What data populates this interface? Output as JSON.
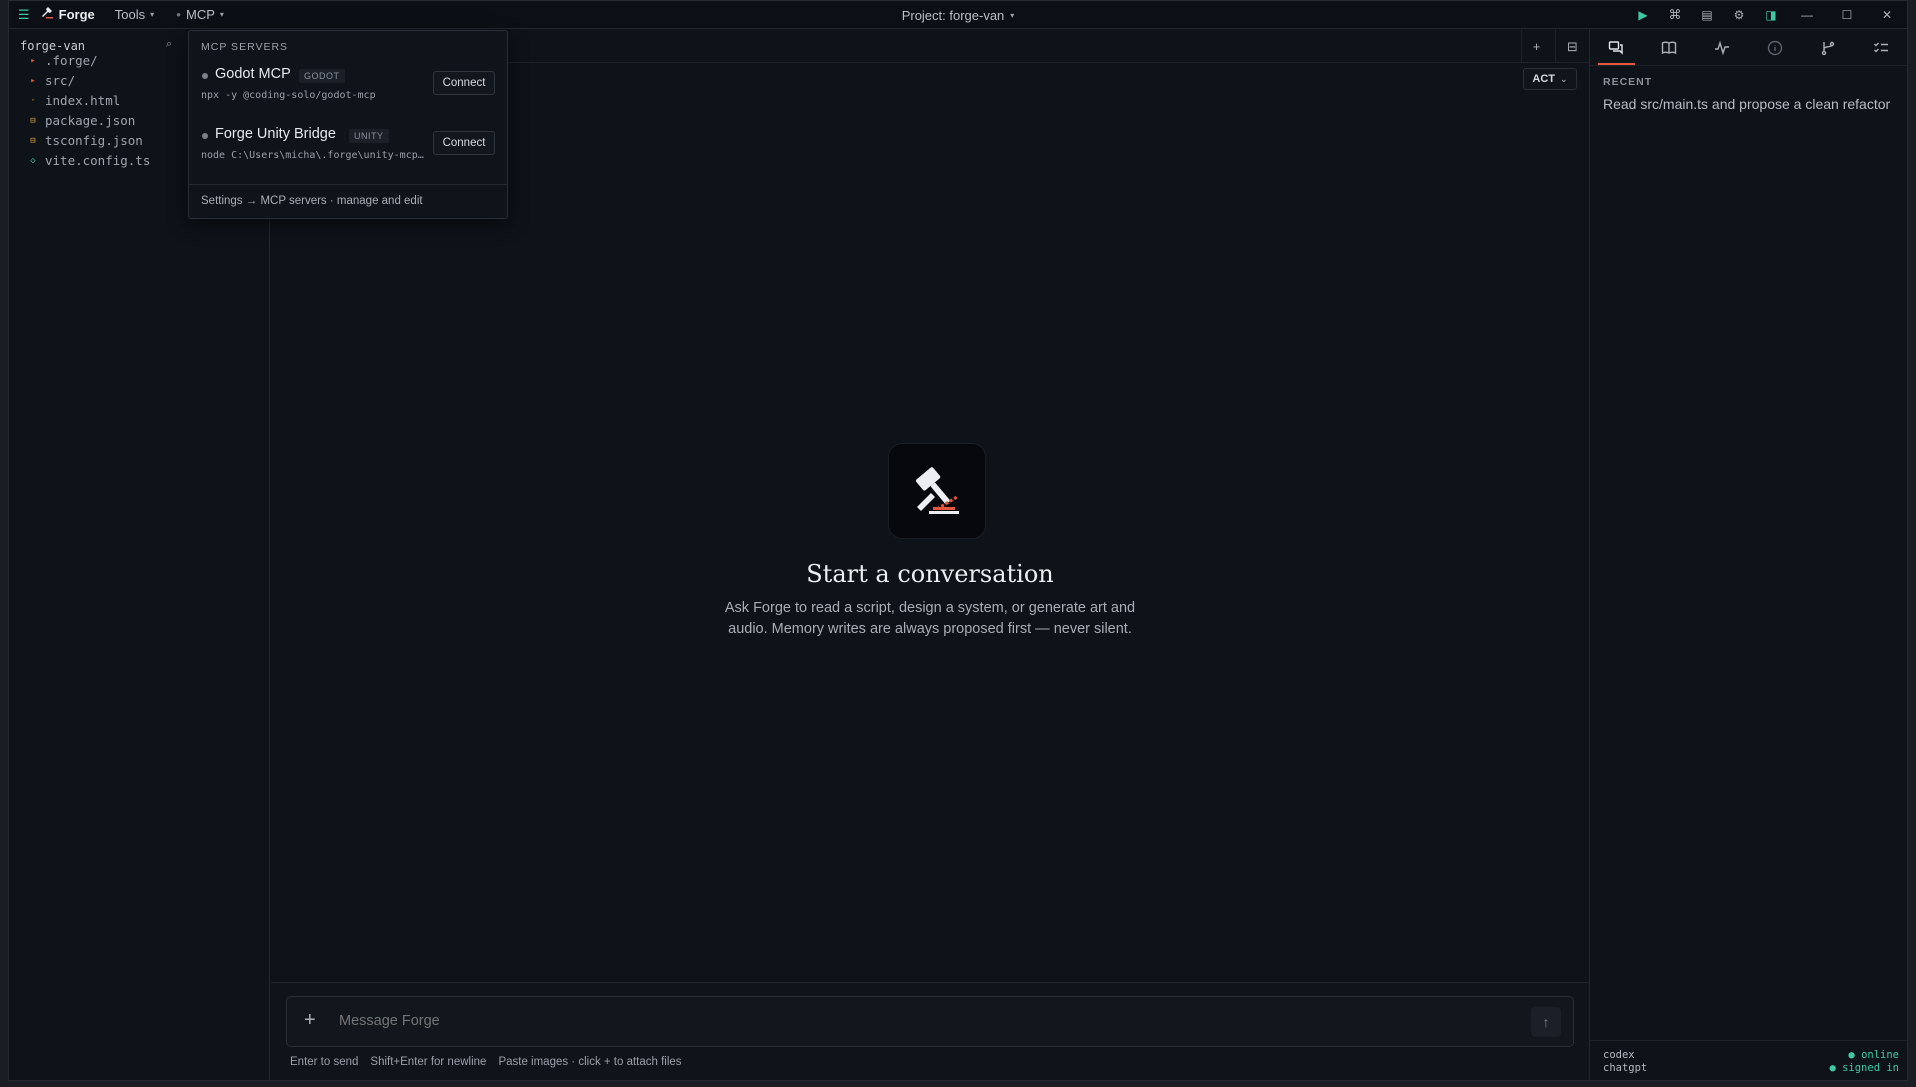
{
  "topbar": {
    "app_name": "Forge",
    "menus": [
      "Tools",
      "MCP"
    ],
    "project": "Project: forge-van"
  },
  "sidebar": {
    "title": "forge-van",
    "files": [
      {
        "name": ".forge/",
        "icon": "folder-icon",
        "color": "#e2563c"
      },
      {
        "name": "src/",
        "icon": "folder-icon",
        "color": "#e2563c"
      },
      {
        "name": "index.html",
        "icon": "file-icon",
        "color": "#d9822b"
      },
      {
        "name": "package.json",
        "icon": "json-icon",
        "color": "#d9a23b"
      },
      {
        "name": "tsconfig.json",
        "icon": "json-icon",
        "color": "#d9a23b"
      },
      {
        "name": "vite.config.ts",
        "icon": "config-icon",
        "color": "#3fc9a1"
      }
    ]
  },
  "main": {
    "mode": "ACT",
    "hero_title": "Start a conversation",
    "hero_subtitle_1": "Ask Forge to read a script, design a system, or generate art and",
    "hero_subtitle_2": "audio. Memory writes are always proposed first — never silent.",
    "composer_placeholder": "Message Forge",
    "hints": [
      "Enter to send",
      "Shift+Enter for newline",
      "Paste images · click + to attach files"
    ]
  },
  "mcp": {
    "header": "MCP SERVERS",
    "servers": [
      {
        "name": "Godot MCP",
        "tag": "GODOT",
        "command": "npx -y @coding-solo/godot-mcp",
        "action": "Connect"
      },
      {
        "name": "Forge Unity Bridge",
        "tag": "UNITY",
        "command": "node C:\\Users\\micha\\.forge\\unity-mcp\\server.js",
        "action": "Connect"
      }
    ],
    "footer": "Settings → MCP servers · manage and edit"
  },
  "right_panel": {
    "recent_label": "RECENT",
    "recent_items": [
      "Read src/main.ts and propose a clean refactor"
    ],
    "status": [
      {
        "name": "codex",
        "state": "● online"
      },
      {
        "name": "chatgpt",
        "state": "● signed in"
      }
    ]
  },
  "colors": {
    "accent": "#e2563c",
    "success": "#3fc9a1",
    "background": "#0e1219"
  }
}
